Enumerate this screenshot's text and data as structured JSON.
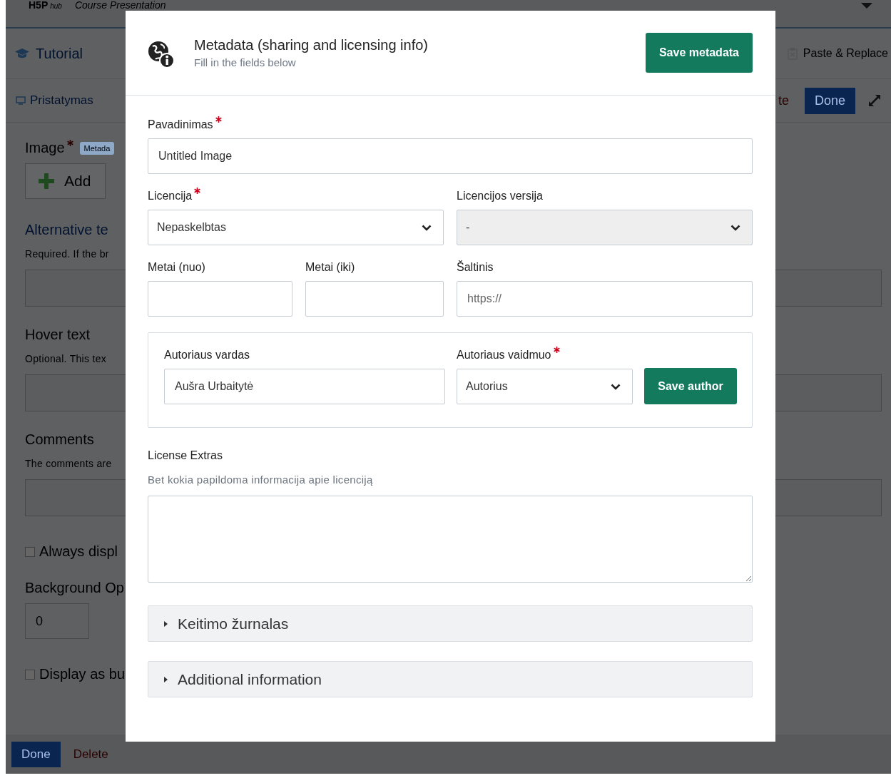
{
  "background": {
    "header": {
      "logo": "H5P",
      "logo_sub": "hub",
      "title": "Course Presentation"
    },
    "tabs": [
      {
        "label": "Tutorial"
      },
      {
        "label": "Paste & Replace"
      }
    ],
    "toolbar": {
      "slide": "Pristatymas",
      "delete": "te",
      "done": "Done"
    },
    "form": [
      {
        "kind": "label",
        "text": "Image",
        "required": true,
        "tag": "Metada"
      },
      {
        "kind": "button",
        "text": "Add"
      },
      {
        "kind": "heading",
        "text": "Alternative te",
        "highlighted": true
      },
      {
        "kind": "hint",
        "text": "Required. If the br"
      },
      {
        "kind": "field"
      },
      {
        "kind": "heading",
        "text": "Hover text",
        "highlighted": false
      },
      {
        "kind": "hint",
        "text": "Optional. This tex"
      },
      {
        "kind": "field"
      },
      {
        "kind": "heading",
        "text": "Comments",
        "highlighted": false
      },
      {
        "kind": "hint",
        "text": "The comments are"
      },
      {
        "kind": "field"
      },
      {
        "kind": "checkbox",
        "text": "Always displ",
        "checked": false
      },
      {
        "kind": "heading",
        "text": "Background Op",
        "highlighted": false
      },
      {
        "kind": "number",
        "value": "0"
      },
      {
        "kind": "checkbox",
        "text": "Display as bu",
        "checked": false
      }
    ],
    "footer": {
      "done": "Done",
      "delete": "Delete"
    }
  },
  "dialog": {
    "title": "Metadata (sharing and licensing info)",
    "subtitle": "Fill in the fields below",
    "save_button": "Save metadata",
    "title_field": {
      "label": "Pavadinimas",
      "required": true,
      "value": "Untitled Image"
    },
    "license": {
      "label": "Licencija",
      "required": true,
      "value": "Nepaskelbtas",
      "disabled": false
    },
    "license_version": {
      "label": "Licencijos versija",
      "required": false,
      "value": "-",
      "disabled": true
    },
    "year_from": {
      "label": "Metai (nuo)"
    },
    "year_to": {
      "label": "Metai (iki)"
    },
    "source": {
      "label": "Šaltinis",
      "placeholder": "https://"
    },
    "author": {
      "name_label": "Autoriaus vardas",
      "name_value": "Aušra Urbaitytė",
      "role_label": "Autoriaus vaidmuo",
      "role_required": true,
      "role_value": "Autorius",
      "save_button": "Save author"
    },
    "license_extras": {
      "label": "License Extras",
      "hint": "Bet kokia papildoma informacija apie licenciją"
    },
    "sections": [
      {
        "label": "Keitimo žurnalas",
        "expanded": false
      },
      {
        "label": "Additional information",
        "expanded": false
      }
    ]
  }
}
